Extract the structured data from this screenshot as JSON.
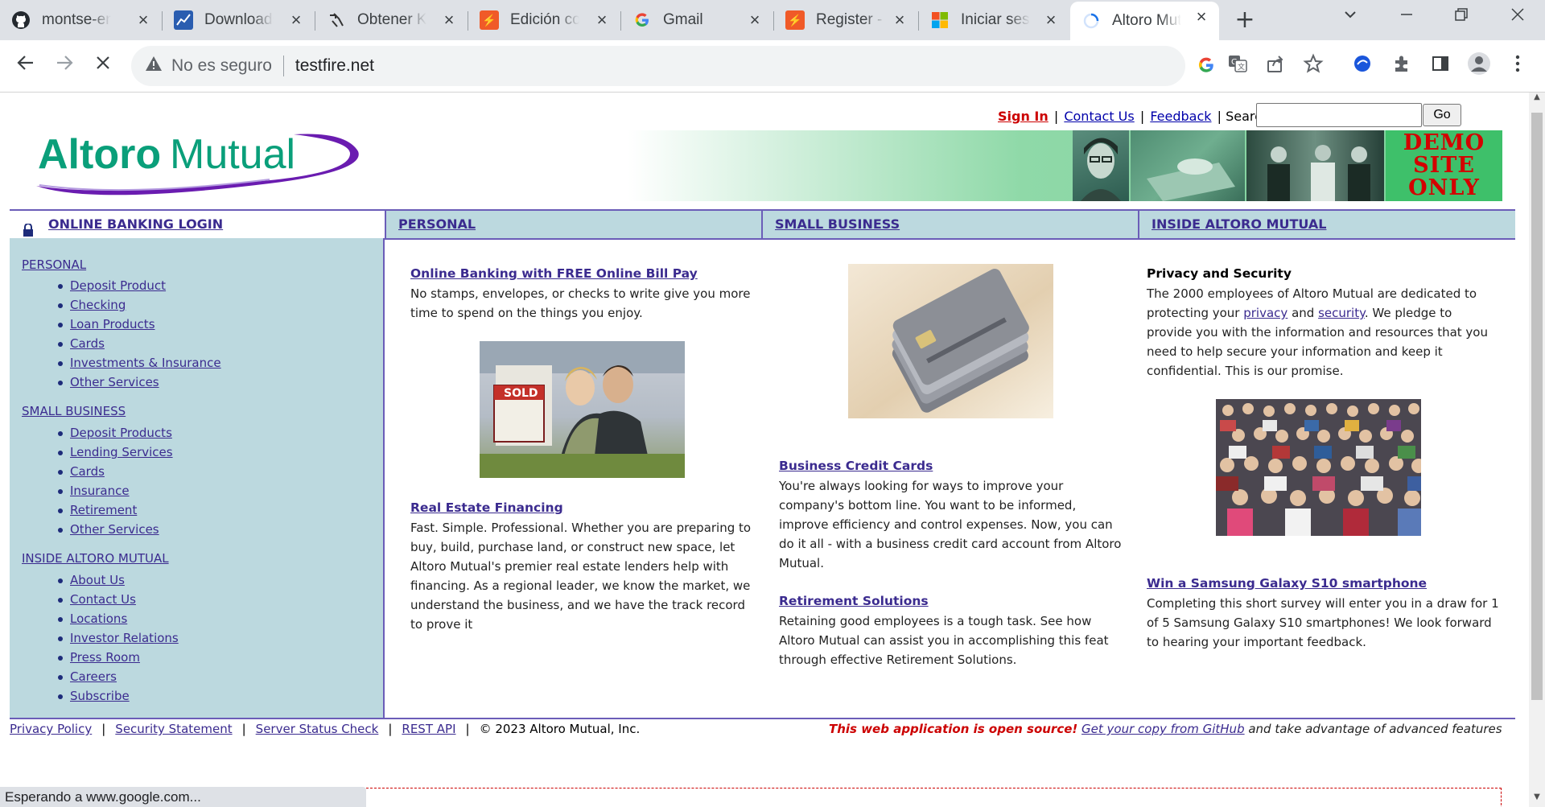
{
  "browser": {
    "tabs": [
      {
        "label": "montse-enr"
      },
      {
        "label": "Downloads"
      },
      {
        "label": "Obtener Ka"
      },
      {
        "label": "Edición con"
      },
      {
        "label": "Gmail"
      },
      {
        "label": "Register - P"
      },
      {
        "label": "Iniciar sesió"
      },
      {
        "label": "Altoro Mutu"
      }
    ],
    "security_label": "No es seguro",
    "url": "testfire.net",
    "status_text": "Esperando a www.google.com...",
    "colors": {
      "tabbar": "#dee1e6",
      "omnibox": "#f1f3f4"
    }
  },
  "header": {
    "logo_text_1": "Altoro",
    "logo_text_2": "Mutual",
    "sign_in": "Sign In",
    "contact_us": "Contact Us",
    "feedback": "Feedback",
    "search_label": "Search",
    "go_button": "Go",
    "demo_badge": [
      "DEMO",
      "SITE",
      "ONLY"
    ]
  },
  "nav": {
    "login": "ONLINE BANKING LOGIN",
    "personal": "PERSONAL",
    "small_business": "SMALL BUSINESS",
    "inside": "INSIDE ALTORO MUTUAL"
  },
  "sidebar": {
    "personal": {
      "heading": "PERSONAL",
      "items": [
        "Deposit Product",
        "Checking",
        "Loan Products",
        "Cards",
        "Investments & Insurance",
        "Other Services"
      ]
    },
    "small_business": {
      "heading": "SMALL BUSINESS",
      "items": [
        "Deposit Products",
        "Lending Services",
        "Cards",
        "Insurance",
        "Retirement",
        "Other Services"
      ]
    },
    "inside": {
      "heading": "INSIDE ALTORO MUTUAL",
      "items": [
        "About Us",
        "Contact Us",
        "Locations",
        "Investor Relations",
        "Press Room",
        "Careers",
        "Subscribe"
      ]
    }
  },
  "content": {
    "col1": {
      "title1": "Online Banking with FREE Online Bill Pay",
      "text1": "No stamps, envelopes, or checks to write give you more time to spend on the things you enjoy.",
      "sold_sign": "SOLD",
      "title2": "Real Estate Financing",
      "text2": "Fast. Simple. Professional. Whether you are preparing to buy, build, purchase land, or construct new space, let Altoro Mutual's premier real estate lenders help with financing. As a regional leader, we know the market, we understand the business, and we have the track record to prove it"
    },
    "col2": {
      "title1": "Business Credit Cards",
      "text1": "You're always looking for ways to improve your company's bottom line. You want to be informed, improve efficiency and control expenses. Now, you can do it all - with a business credit card account from Altoro Mutual.",
      "title2": "Retirement Solutions",
      "text2": "Retaining good employees is a tough task. See how Altoro Mutual can assist you in accomplishing this feat through effective Retirement Solutions."
    },
    "col3": {
      "title1": "Privacy and Security",
      "text1_a": "The 2000 employees of Altoro Mutual are dedicated to protecting your ",
      "privacy_link": "privacy",
      "text1_b": " and ",
      "security_link": "security",
      "text1_c": ". We pledge to provide you with the information and resources that you need to help secure your information and keep it confidential. This is our promise.",
      "title2": "Win a Samsung Galaxy S10 smartphone",
      "text2": "Completing this short survey will enter you in a draw for 1 of 5 Samsung Galaxy S10 smartphones! We look forward to hearing your important feedback."
    }
  },
  "footer": {
    "privacy": "Privacy Policy",
    "security": "Security Statement",
    "server": "Server Status Check",
    "rest": "REST API",
    "copyright": "© 2023 Altoro Mutual, Inc.",
    "open_source": "This web application is open source!",
    "github": "Get your copy from GitHub",
    "advanced": " and take advantage of advanced features"
  },
  "theme": {
    "nav_bg": "#bcd9df",
    "border": "#6b5db8",
    "link": "#3b2b8f",
    "alert_red": "#cc0000"
  }
}
